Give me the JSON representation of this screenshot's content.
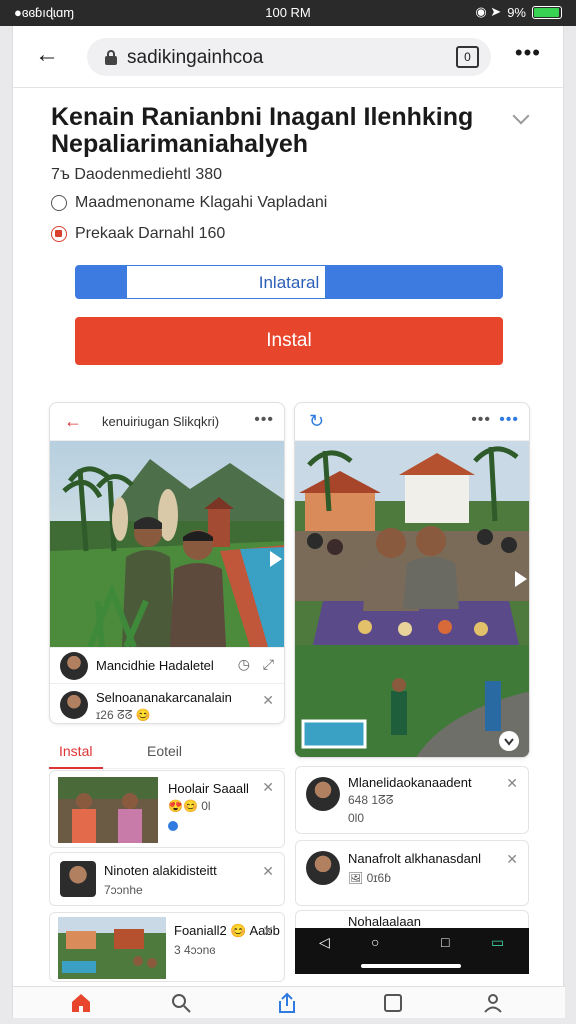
{
  "status_bar": {
    "left_text": "●ɞɞɓıɖɩɑɱ",
    "time": "100 RM",
    "battery_text": "9%",
    "battery_level": 0.9
  },
  "browser": {
    "url": "sadikingainhcoa"
  },
  "app": {
    "title": "Kenain Ranianbni Inaganl Ilenhking Nepaliarimaniahalyeh",
    "meta": [
      "7ъ  Daodenmediehtl 380",
      "Maadmenoname Klagahi Vapladani",
      "Prekaak Darnahl 160"
    ],
    "progress_label": "Inlataral",
    "progress_fraction": 0.12,
    "install_label": "Instal"
  },
  "card_left": {
    "header": "kenuiriugan Slikqkri)",
    "post1": {
      "name": "Mancidhie Hadaletel"
    },
    "post2": {
      "name": "Selnoananakarcanalain",
      "sub": "ɪ26 ᘔᘔ 😊"
    }
  },
  "mini_tabs": {
    "active": "Instal",
    "other": "Eoteil"
  },
  "list_left": [
    {
      "title": "Hoolair Saaall",
      "sub": "😍😊 0l"
    },
    {
      "title": "Ninoten alakidisteitt",
      "sub": "7ɔɔnhe"
    },
    {
      "title": "Foaniall2 😊 Aabb",
      "sub": "3 4ɔɔnɞ"
    }
  ],
  "list_right": [
    {
      "title": "Mlanelidaokanaadent",
      "sub": "648 1ᘔᘔ",
      "sub2": "0l0"
    },
    {
      "title": "Nanafrolt alkhanasdanl",
      "sub": "🖼 0ɪ6ɓ"
    },
    {
      "title": "Nohalaalaan",
      "sub": ""
    }
  ],
  "colors": {
    "accent_blue": "#3e7be0",
    "install_red": "#e8462c",
    "battery_green": "#39d353"
  },
  "icons": [
    "back-icon",
    "lock-icon",
    "tabs-icon",
    "more-icon",
    "chevron-down-icon",
    "home-icon",
    "search-icon",
    "share-icon",
    "square-icon",
    "profile-icon"
  ]
}
